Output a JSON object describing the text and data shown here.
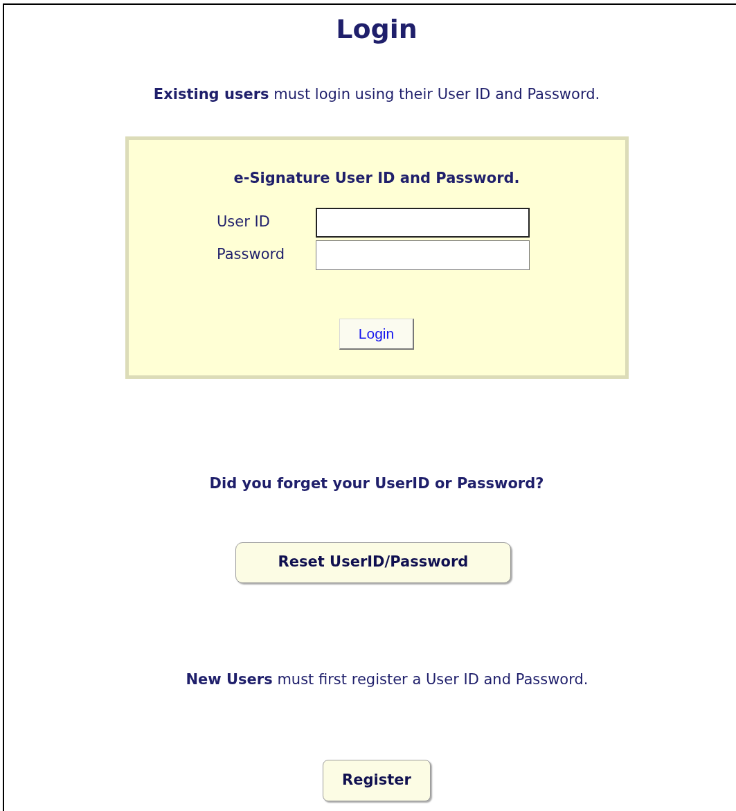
{
  "page_title": "Login",
  "intro": "**Existing users** must login using their User ID and Password.",
  "login_box": {
    "heading": "e-Signature User ID and Password.",
    "fields": [
      {
        "label": "User ID",
        "focused": true
      },
      {
        "label": "Password",
        "focused": false
      }
    ],
    "button": "Login"
  },
  "forgot": {
    "question": "Did you forget your UserID or Password?",
    "button": "Reset UserID/Password"
  },
  "new_users": {
    "text": "**New Users** must first register a User ID and Password.",
    "button": "Register"
  }
}
